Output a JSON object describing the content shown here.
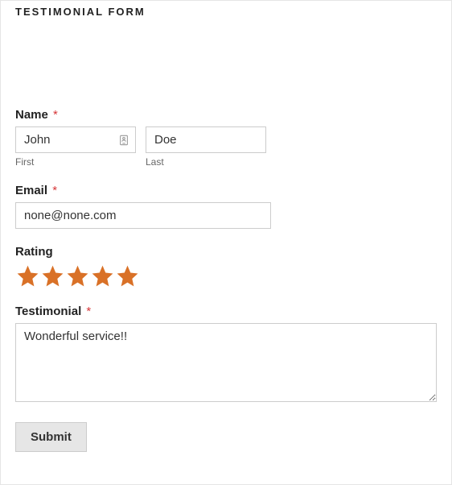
{
  "title": "TESTIMONIAL FORM",
  "fields": {
    "name": {
      "label": "Name",
      "first": {
        "value": "John",
        "sublabel": "First"
      },
      "last": {
        "value": "Doe",
        "sublabel": "Last"
      }
    },
    "email": {
      "label": "Email",
      "value": "none@none.com"
    },
    "rating": {
      "label": "Rating",
      "value": 5
    },
    "testimonial": {
      "label": "Testimonial",
      "value": "Wonderful service!!"
    }
  },
  "required_marker": "*",
  "submit_label": "Submit"
}
